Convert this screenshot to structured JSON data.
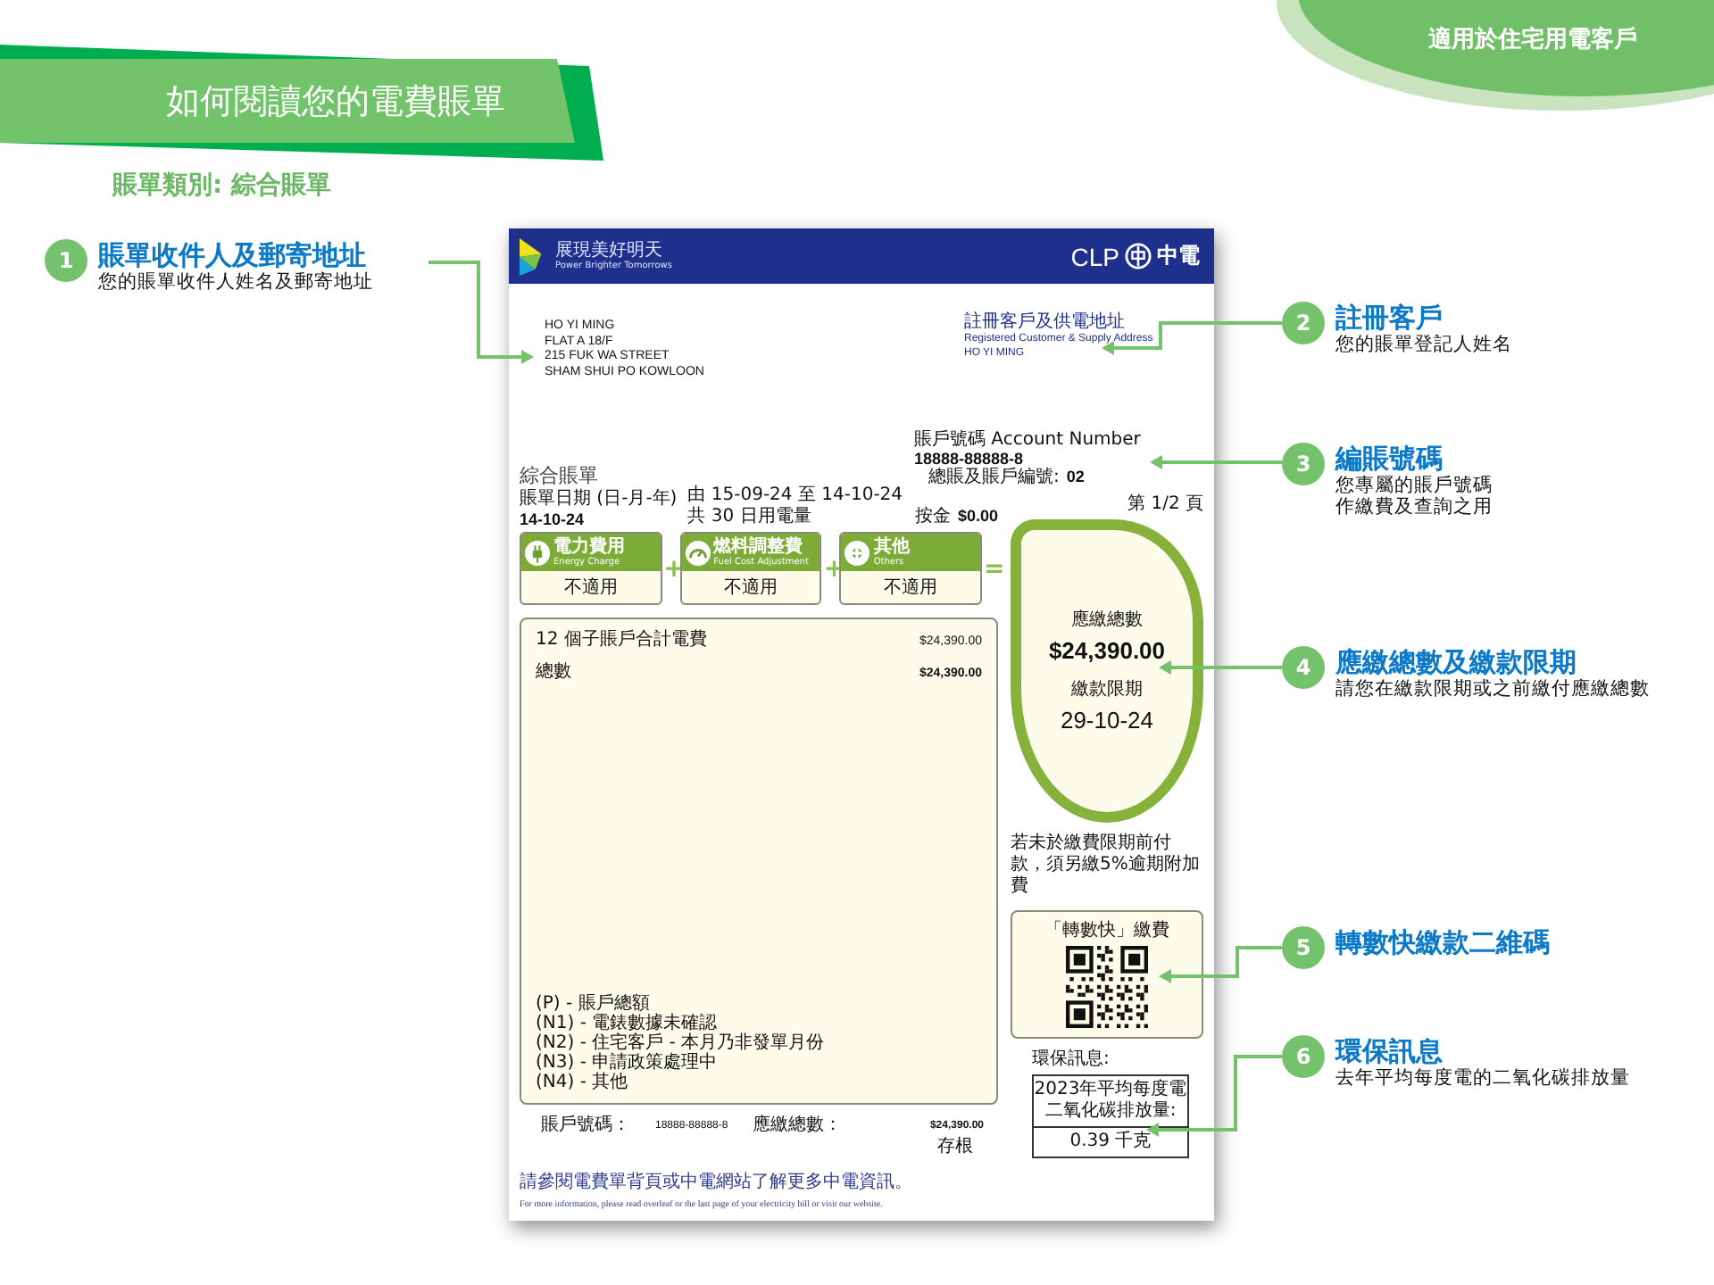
{
  "header": {
    "title": "如何閱讀您的電費賬單",
    "subtitle": "賬單類別: 綜合賬單",
    "audience": "適用於住宅用電客戶"
  },
  "annotations": [
    {
      "number": "1",
      "title": "賬單收件人及郵寄地址",
      "description": [
        "您的賬單收件人姓名及郵寄地址"
      ]
    },
    {
      "number": "2",
      "title": "註冊客戶",
      "description": [
        "您的賬單登記人姓名"
      ]
    },
    {
      "number": "3",
      "title": "編賬號碼",
      "description": [
        "您專屬的賬戶號碼",
        "作繳費及查詢之用"
      ]
    },
    {
      "number": "4",
      "title": "應繳總數及繳款限期",
      "description": [
        "請您在繳款限期或之前繳付應繳總數"
      ]
    },
    {
      "number": "5",
      "title": "轉數快繳款二維碼"
    },
    {
      "number": "6",
      "title": "環保訊息",
      "description": [
        "去年平均每度電的二氧化碳排放量"
      ]
    }
  ],
  "bill": {
    "slogan_zh": "展現美好明天",
    "slogan_en": "Power Brighter Tomorrows",
    "brand": "CLP",
    "brand_zh": "中電",
    "mailing_address": [
      "HO YI MING",
      "FLAT A 18/F",
      "215 FUK WA STREET",
      "SHAM SHUI PO KOWLOON"
    ],
    "registered": {
      "label_zh": "註冊客戶及供電地址",
      "label_en": "Registered Customer & Supply Address",
      "name": "HO YI MING"
    },
    "account": {
      "label": "賬戶號碼 Account Number",
      "number": "18888-88888-8",
      "sub_label": "總賬及賬戶編號:",
      "sub_value": "02"
    },
    "bill_type": "綜合賬單",
    "date_label": "賬單日期 (日-月-年)",
    "bill_date": "14-10-24",
    "period": "由 15-09-24 至 14-10-24",
    "days": "共 30 日用電量",
    "deposit_label": "按金",
    "deposit": "$0.00",
    "page": "第 1/2 頁",
    "charges": [
      {
        "kind": "plug",
        "label_zh": "電力費用",
        "label_en": "Energy Charge",
        "value": "不適用"
      },
      {
        "kind": "gauge",
        "label_zh": "燃料調整費",
        "label_en": "Fuel Cost Adjustment",
        "value": "不適用"
      },
      {
        "kind": "others",
        "label_zh": "其他",
        "label_en": "Others",
        "value": "不適用"
      }
    ],
    "operators": [
      "+",
      "+",
      "="
    ],
    "total": {
      "label": "應繳總數",
      "amount": "$24,390.00",
      "due_label": "繳款限期",
      "due_date": "29-10-24"
    },
    "late_note": "若未於繳費限期前付款，須另繳5%逾期附加費",
    "lines": [
      {
        "description": "12 個子賬戶合計電費",
        "amount": "$24,390.00",
        "bold": false
      },
      {
        "description": "總數",
        "amount": "$24,390.00",
        "bold": true
      }
    ],
    "footnotes": [
      "(P) - 賬戶總額",
      "(N1) - 電錶數據未確認",
      "(N2) - 住宅客戶 - 本月乃非發單月份",
      "(N3) - 申請政策處理中",
      "(N4) - 其他"
    ],
    "stub": {
      "account_label": "賬戶號碼：",
      "account": "18888-88888-8",
      "total_label": "應繳總數：",
      "total": "$24,390.00",
      "note": "存根"
    },
    "fps": {
      "title": "「轉數快」繳費"
    },
    "eco": {
      "label": "環保訊息:",
      "heading": [
        "2023年平均每度電",
        "二氧化碳排放量:"
      ],
      "value": "0.39 千克"
    },
    "footer_zh": "請參閱電費單背頁或中電網站了解更多中電資訊。",
    "footer_en": "For more information, please read overleaf or the last page of your electricity bill or visit our website."
  }
}
